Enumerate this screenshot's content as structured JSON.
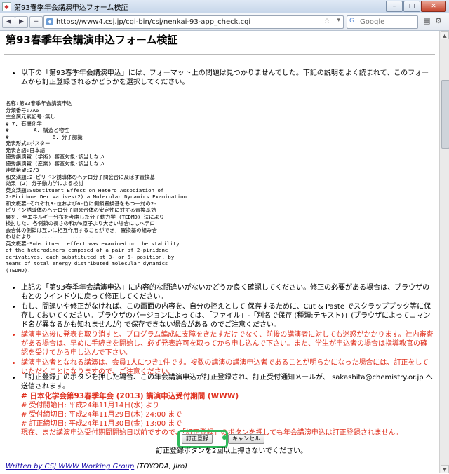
{
  "window": {
    "title": "第93春季年会講演申込フォーム検証",
    "min": "–",
    "max": "□",
    "close": "✕"
  },
  "browser": {
    "url": "https://www4.csj.jp/cgi-bin/csj/nenkai-93-app_check.cgi",
    "search_placeholder": "Google"
  },
  "page": {
    "title": "第93春季年会講演申込フォーム検証",
    "intro": "以下の「第93春季年会講演申込」には、フォーマット上の問題は見つかりませんでした。下記の説明をよく読まれて、このフォームから訂正登録されるかどうかを選択してください。",
    "summary_lines": [
      "名称:第93春季年会講演申込",
      "分類番号:7A6",
      "主金属元素記号:無し",
      "# 7. 有機化学",
      "#        A. 構造と物性",
      "#              6. 分子認識",
      "発表形式:ポスター",
      "発表言語:日本語",
      "優秀講演賞 (学術) 審査対象:該当しない",
      "優秀講演賞 (産業) 審査対象:該当しない",
      "連続希望:2/3",
      "和文演題:2-ピリドン誘導体のヘテロ分子間会合に及ぼす置換基",
      "効果 (2) 分子動力学による検討",
      "英文演題:Substituent Effect on Hetero Association of",
      "2-Piridone Derivatives(2) a Molecular Dynamics Examination",
      "和文概要:それぞれ3-位および6-位に側鎖置換基をもつ一対の2-",
      "ピリドン誘導体のヘテロ分子間会合体の安定性に対する置換基効",
      "果を, 全エネルギー分布を考慮した分子動力学 (TEDMD) 法により",
      "検討した. 各側鎖の長さの和が6原子より大きい場合にはヘテロ",
      "会合体の側鎖は互いに相互作用することができ, 置換基の組み合",
      "わせにより.......................",
      "英文概要:Substituent effect was examined on the stability",
      "of the heterodimers composed of a pair of 2-piridone",
      "derivatives, each substituted at 3- or 6- position, by",
      "means of total energy distributed molecular dynamics",
      "(TEDMD)."
    ],
    "instructions": [
      {
        "text": "上記の「第93春季年会講演申込」に内容的な間違いがないかどうか良く確認してください。修正の必要がある場合は、ブラウザのもとのウインドウに戻って修正してください。",
        "red": false
      },
      {
        "text": "もし、間違いや修正がなければ、この画面の内容を、自分の控えとして 保存するために、Cut & Paste でスクラップブック等に保存しておいてください。ブラウザのバージョンによっては、「ファイル」-「別名で保存 (種類:テキスト)」(ブラウザによってコマンド名が異なるかも知れませんが) で保存できない場合がある のでご注意ください。",
        "red": false
      },
      {
        "text": "講演申込後に発表を取り消すと、プログラム編成に支障をきたすだけでなく、前後の講演者に対しても迷惑がかかります。社内審査がある場合は、早めに手続きを開始し、必ず発表許可を取ってから申し込んで下さい。また、学生が申込者の場合は指導教官の確認を受けてから申し込んで下さい。",
        "red": true
      },
      {
        "text": "講演申込者となれる講演は、会員1人につき1件です。複数の講演の講演申込者であることが明らかになった場合には、訂正をしていただくことになりますので、ご注意ください。",
        "red": true
      }
    ],
    "notice": {
      "lead": "「訂正登録」のボタンを押した場合、この年会講演申込が訂正登録され、訂正受付通知メールが、 sakashita@chemistry.or.jp へ送信されます。",
      "heading": "# 日本化学会第93春季年会 (2013) 講演申込受付期間 (WWW)",
      "lines": [
        "# 受付開始日: 平成24年11月14日(水) より",
        "# 受付締切日: 平成24年11月29日(木) 24:00 まで",
        "# 訂正締切日: 平成24年11月30日(金) 13:00 まで"
      ],
      "warning": "現在、まだ講演申込受付期間開始日以前ですので、「訂正登録」のボタンを押しても年会講演申込は訂正登録されません。"
    },
    "submit_label": "訂正登録",
    "cancel_label": "キャンセル",
    "button_note": "訂正登録ボタンを2回以上押さないでください。",
    "footer_link": "Written by CSJ WWW Working Group",
    "footer_author": " (TOYODA, Jiro)"
  }
}
